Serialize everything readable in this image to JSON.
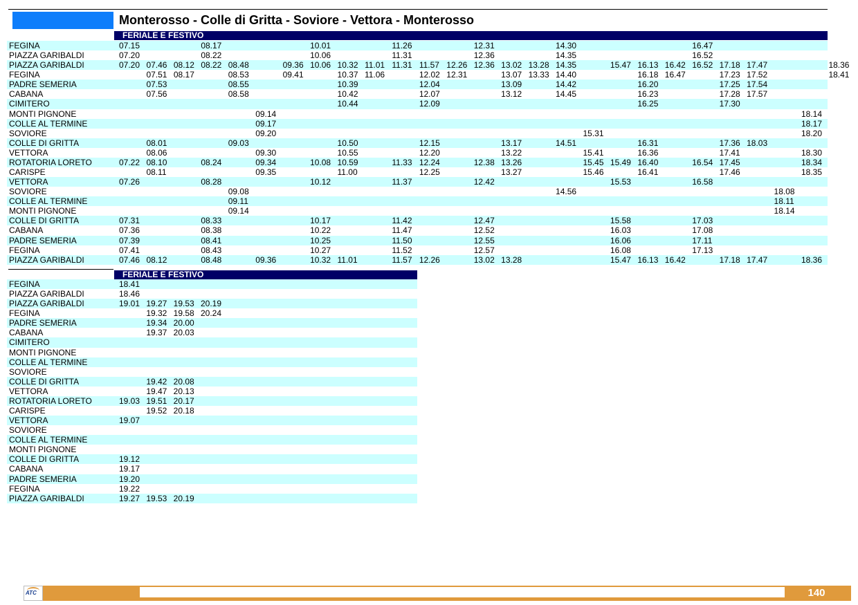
{
  "title": "Monterosso - Colle di Gritta - Soviore - Vettora - Monterosso",
  "page_number": "140",
  "logo": {
    "text": "ATC",
    "icon": "atc-logo-icon"
  },
  "colors": {
    "title_box": "#0d7dfb",
    "band": "#000066",
    "row_highlight": "#ccffff",
    "footer": "#e09a3c"
  },
  "tables": [
    {
      "header": "FERIALE E FESTIVO",
      "rows": [
        {
          "stop": "FEGINA",
          "times": [
            "07.15",
            "",
            "",
            "08.17",
            "",
            "",
            "",
            "10.01",
            "",
            "",
            "11.26",
            "",
            "",
            "12.31",
            "",
            "",
            "14.30",
            "",
            "",
            "",
            "",
            "16.47",
            "",
            "",
            "",
            "",
            ""
          ]
        },
        {
          "stop": "PIAZZA GARIBALDI",
          "times": [
            "07.20",
            "",
            "",
            "08.22",
            "",
            "",
            "",
            "10.06",
            "",
            "",
            "11.31",
            "",
            "",
            "12.36",
            "",
            "",
            "14.35",
            "",
            "",
            "",
            "",
            "16.52",
            "",
            "",
            "",
            "",
            ""
          ]
        },
        {
          "stop": "PIAZZA GARIBALDI",
          "times": [
            "07.20",
            "07.46",
            "08.12",
            "08.22",
            "08.48",
            "",
            "09.36",
            "10.06",
            "10.32",
            "11.01",
            "11.31",
            "11.57",
            "12.26",
            "12.36",
            "13.02",
            "13.28",
            "14.35",
            "",
            "15.47",
            "16.13",
            "16.42",
            "16.52",
            "17.18",
            "17.47",
            "",
            "",
            "18.36"
          ]
        },
        {
          "stop": "FEGINA",
          "times": [
            "",
            "07.51",
            "08.17",
            "",
            "08.53",
            "",
            "09.41",
            "",
            "10.37",
            "11.06",
            "",
            "12.02",
            "12.31",
            "",
            "13.07",
            "13.33",
            "14.40",
            "",
            "",
            "16.18",
            "16.47",
            "",
            "17.23",
            "17.52",
            "",
            "",
            "18.41"
          ]
        },
        {
          "stop": "PADRE SEMERIA",
          "times": [
            "",
            "07.53",
            "",
            "",
            "08.55",
            "",
            "",
            "",
            "10.39",
            "",
            "",
            "12.04",
            "",
            "",
            "13.09",
            "",
            "14.42",
            "",
            "",
            "16.20",
            "",
            "",
            "17.25",
            "17.54",
            "",
            "",
            ""
          ]
        },
        {
          "stop": "CABANA",
          "times": [
            "",
            "07.56",
            "",
            "",
            "08.58",
            "",
            "",
            "",
            "10.42",
            "",
            "",
            "12.07",
            "",
            "",
            "13.12",
            "",
            "14.45",
            "",
            "",
            "16.23",
            "",
            "",
            "17.28",
            "17.57",
            "",
            "",
            ""
          ]
        },
        {
          "stop": "CIMITERO",
          "times": [
            "",
            "",
            "",
            "",
            "",
            "",
            "",
            "",
            "10.44",
            "",
            "",
            "12.09",
            "",
            "",
            "",
            "",
            "",
            "",
            "",
            "16.25",
            "",
            "",
            "17.30",
            "",
            "",
            "",
            ""
          ]
        },
        {
          "stop": "MONTI PIGNONE",
          "times": [
            "",
            "",
            "",
            "",
            "",
            "09.14",
            "",
            "",
            "",
            "",
            "",
            "",
            "",
            "",
            "",
            "",
            "",
            "",
            "",
            "",
            "",
            "",
            "",
            "",
            "",
            "18.14",
            ""
          ]
        },
        {
          "stop": "COLLE AL TERMINE",
          "times": [
            "",
            "",
            "",
            "",
            "",
            "09.17",
            "",
            "",
            "",
            "",
            "",
            "",
            "",
            "",
            "",
            "",
            "",
            "",
            "",
            "",
            "",
            "",
            "",
            "",
            "",
            "18.17",
            ""
          ]
        },
        {
          "stop": "SOVIORE",
          "times": [
            "",
            "",
            "",
            "",
            "",
            "09.20",
            "",
            "",
            "",
            "",
            "",
            "",
            "",
            "",
            "",
            "",
            "",
            "15.31",
            "",
            "",
            "",
            "",
            "",
            "",
            "",
            "18.20",
            ""
          ]
        },
        {
          "stop": "COLLE DI GRITTA",
          "times": [
            "",
            "08.01",
            "",
            "",
            "09.03",
            "",
            "",
            "",
            "10.50",
            "",
            "",
            "12.15",
            "",
            "",
            "13.17",
            "",
            "14.51",
            "",
            "",
            "16.31",
            "",
            "",
            "17.36",
            "18.03",
            "",
            "",
            ""
          ]
        },
        {
          "stop": "VETTORA",
          "times": [
            "",
            "08.06",
            "",
            "",
            "",
            "09.30",
            "",
            "",
            "10.55",
            "",
            "",
            "12.20",
            "",
            "",
            "13.22",
            "",
            "",
            "15.41",
            "",
            "16.36",
            "",
            "",
            "17.41",
            "",
            "",
            "18.30",
            ""
          ]
        },
        {
          "stop": "ROTATORIA LORETO",
          "times": [
            "07.22",
            "08.10",
            "",
            "08.24",
            "",
            "09.34",
            "",
            "10.08",
            "10.59",
            "",
            "11.33",
            "12.24",
            "",
            "12.38",
            "13.26",
            "",
            "",
            "15.45",
            "15.49",
            "16.40",
            "",
            "16.54",
            "17.45",
            "",
            "",
            "18.34",
            ""
          ]
        },
        {
          "stop": "CARISPE",
          "times": [
            "",
            "08.11",
            "",
            "",
            "",
            "09.35",
            "",
            "",
            "11.00",
            "",
            "",
            "12.25",
            "",
            "",
            "13.27",
            "",
            "",
            "15.46",
            "",
            "16.41",
            "",
            "",
            "17.46",
            "",
            "",
            "18.35",
            ""
          ]
        },
        {
          "stop": "VETTORA",
          "times": [
            "07.26",
            "",
            "",
            "08.28",
            "",
            "",
            "",
            "10.12",
            "",
            "",
            "11.37",
            "",
            "",
            "12.42",
            "",
            "",
            "",
            "",
            "15.53",
            "",
            "",
            "16.58",
            "",
            "",
            "",
            "",
            ""
          ]
        },
        {
          "stop": "SOVIORE",
          "times": [
            "",
            "",
            "",
            "",
            "09.08",
            "",
            "",
            "",
            "",
            "",
            "",
            "",
            "",
            "",
            "",
            "",
            "14.56",
            "",
            "",
            "",
            "",
            "",
            "",
            "",
            "18.08",
            "",
            ""
          ]
        },
        {
          "stop": "COLLE AL TERMINE",
          "times": [
            "",
            "",
            "",
            "",
            "09.11",
            "",
            "",
            "",
            "",
            "",
            "",
            "",
            "",
            "",
            "",
            "",
            "",
            "",
            "",
            "",
            "",
            "",
            "",
            "",
            "18.11",
            "",
            ""
          ]
        },
        {
          "stop": "MONTI PIGNONE",
          "times": [
            "",
            "",
            "",
            "",
            "09.14",
            "",
            "",
            "",
            "",
            "",
            "",
            "",
            "",
            "",
            "",
            "",
            "",
            "",
            "",
            "",
            "",
            "",
            "",
            "",
            "18.14",
            "",
            ""
          ]
        },
        {
          "stop": "COLLE DI GRITTA",
          "times": [
            "07.31",
            "",
            "",
            "08.33",
            "",
            "",
            "",
            "10.17",
            "",
            "",
            "11.42",
            "",
            "",
            "12.47",
            "",
            "",
            "",
            "",
            "15.58",
            "",
            "",
            "17.03",
            "",
            "",
            "",
            "",
            ""
          ]
        },
        {
          "stop": "CABANA",
          "times": [
            "07.36",
            "",
            "",
            "08.38",
            "",
            "",
            "",
            "10.22",
            "",
            "",
            "11.47",
            "",
            "",
            "12.52",
            "",
            "",
            "",
            "",
            "16.03",
            "",
            "",
            "17.08",
            "",
            "",
            "",
            "",
            ""
          ]
        },
        {
          "stop": "PADRE SEMERIA",
          "times": [
            "07.39",
            "",
            "",
            "08.41",
            "",
            "",
            "",
            "10.25",
            "",
            "",
            "11.50",
            "",
            "",
            "12.55",
            "",
            "",
            "",
            "",
            "16.06",
            "",
            "",
            "17.11",
            "",
            "",
            "",
            "",
            ""
          ]
        },
        {
          "stop": "FEGINA",
          "times": [
            "07.41",
            "",
            "",
            "08.43",
            "",
            "",
            "",
            "10.27",
            "",
            "",
            "11.52",
            "",
            "",
            "12.57",
            "",
            "",
            "",
            "",
            "16.08",
            "",
            "",
            "17.13",
            "",
            "",
            "",
            "",
            ""
          ]
        },
        {
          "stop": "PIAZZA GARIBALDI",
          "times": [
            "07.46",
            "08.12",
            "",
            "08.48",
            "",
            "09.36",
            "",
            "10.32",
            "11.01",
            "",
            "11.57",
            "12.26",
            "",
            "13.02",
            "13.28",
            "",
            "",
            "",
            "15.47",
            "16.13",
            "16.42",
            "",
            "17.18",
            "17.47",
            "",
            "18.36",
            ""
          ]
        }
      ]
    },
    {
      "header": "FERIALE E FESTIVO",
      "rows": [
        {
          "stop": "FEGINA",
          "times": [
            "18.41",
            "",
            "",
            ""
          ]
        },
        {
          "stop": "PIAZZA GARIBALDI",
          "times": [
            "18.46",
            "",
            "",
            ""
          ]
        },
        {
          "stop": "PIAZZA GARIBALDI",
          "times": [
            "19.01",
            "19.27",
            "19.53",
            "20.19"
          ]
        },
        {
          "stop": "FEGINA",
          "times": [
            "",
            "19.32",
            "19.58",
            "20.24"
          ]
        },
        {
          "stop": "PADRE SEMERIA",
          "times": [
            "",
            "19.34",
            "20.00",
            ""
          ]
        },
        {
          "stop": "CABANA",
          "times": [
            "",
            "19.37",
            "20.03",
            ""
          ]
        },
        {
          "stop": "CIMITERO",
          "times": [
            "",
            "",
            "",
            ""
          ]
        },
        {
          "stop": "MONTI PIGNONE",
          "times": [
            "",
            "",
            "",
            ""
          ]
        },
        {
          "stop": "COLLE AL TERMINE",
          "times": [
            "",
            "",
            "",
            ""
          ]
        },
        {
          "stop": "SOVIORE",
          "times": [
            "",
            "",
            "",
            ""
          ]
        },
        {
          "stop": "COLLE DI GRITTA",
          "times": [
            "",
            "19.42",
            "20.08",
            ""
          ]
        },
        {
          "stop": "VETTORA",
          "times": [
            "",
            "19.47",
            "20.13",
            ""
          ]
        },
        {
          "stop": "ROTATORIA LORETO",
          "times": [
            "19.03",
            "19.51",
            "20.17",
            ""
          ]
        },
        {
          "stop": "CARISPE",
          "times": [
            "",
            "19.52",
            "20.18",
            ""
          ]
        },
        {
          "stop": "VETTORA",
          "times": [
            "19.07",
            "",
            "",
            ""
          ]
        },
        {
          "stop": "SOVIORE",
          "times": [
            "",
            "",
            "",
            ""
          ]
        },
        {
          "stop": "COLLE AL TERMINE",
          "times": [
            "",
            "",
            "",
            ""
          ]
        },
        {
          "stop": "MONTI PIGNONE",
          "times": [
            "",
            "",
            "",
            ""
          ]
        },
        {
          "stop": "COLLE DI GRITTA",
          "times": [
            "19.12",
            "",
            "",
            ""
          ]
        },
        {
          "stop": "CABANA",
          "times": [
            "19.17",
            "",
            "",
            ""
          ]
        },
        {
          "stop": "PADRE SEMERIA",
          "times": [
            "19.20",
            "",
            "",
            ""
          ]
        },
        {
          "stop": "FEGINA",
          "times": [
            "19.22",
            "",
            "",
            ""
          ]
        },
        {
          "stop": "PIAZZA GARIBALDI",
          "times": [
            "19.27",
            "19.53",
            "20.19",
            ""
          ]
        }
      ]
    }
  ]
}
